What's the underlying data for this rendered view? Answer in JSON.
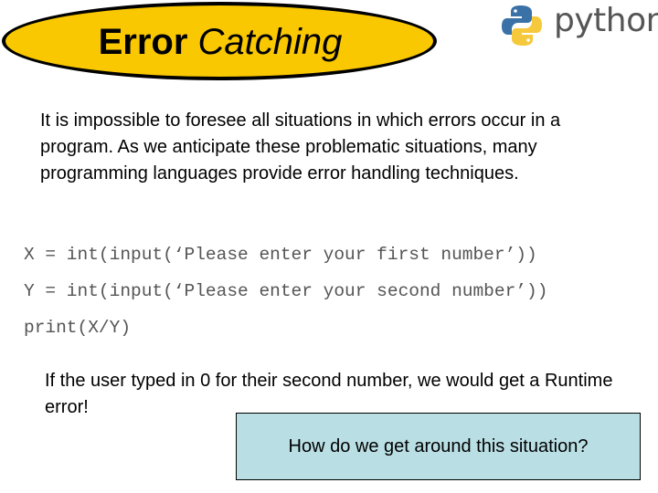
{
  "title": {
    "bold_part": "Error",
    "italic_part": "Catching",
    "fill_color": "#f9c800"
  },
  "logo": {
    "icon": "python-logo-icon",
    "text": "python"
  },
  "intro_text": "It is impossible to foresee all situations in which errors occur in a program. As we anticipate these problematic situations, many programming languages provide error handling techniques.",
  "code_lines": [
    "X = int(input(‘Please enter your first number’))",
    "Y = int(input(‘Please enter your second number’))",
    "print(X/Y)"
  ],
  "note_text": "If the user typed in 0 for their second number, we would get a Runtime error!",
  "question_box": {
    "text": "How do we get around this situation?",
    "fill_color": "#b9dfe4"
  }
}
